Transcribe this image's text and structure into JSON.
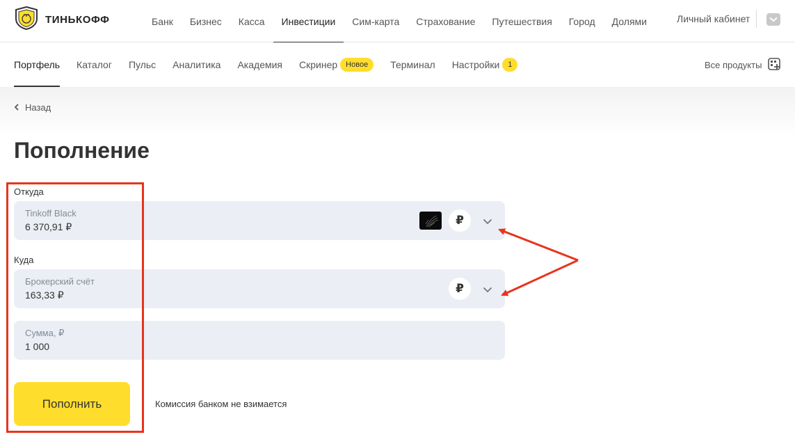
{
  "logo": {
    "text": "ТИНЬКОФФ",
    "icon": "tinkoff-shield-icon"
  },
  "top_nav": {
    "items": [
      {
        "label": "Банк",
        "active": false
      },
      {
        "label": "Бизнес",
        "active": false
      },
      {
        "label": "Касса",
        "active": false
      },
      {
        "label": "Инвестиции",
        "active": true
      },
      {
        "label": "Сим-карта",
        "active": false
      },
      {
        "label": "Страхование",
        "active": false
      },
      {
        "label": "Путешествия",
        "active": false
      },
      {
        "label": "Город",
        "active": false
      },
      {
        "label": "Долями",
        "active": false
      }
    ],
    "cabinet_label": "Личный кабинет",
    "cabinet_icon": "chevron-down-icon"
  },
  "sub_nav": {
    "items": [
      {
        "label": "Портфель",
        "active": true
      },
      {
        "label": "Каталог"
      },
      {
        "label": "Пульс"
      },
      {
        "label": "Аналитика"
      },
      {
        "label": "Академия"
      },
      {
        "label": "Скринер",
        "badge": "Новое"
      },
      {
        "label": "Терминал"
      },
      {
        "label": "Настройки",
        "badge": "1"
      }
    ],
    "all_products_label": "Все продукты",
    "all_products_icon": "grid-plus-icon"
  },
  "back_label": "Назад",
  "page_title": "Пополнение",
  "from": {
    "section_label": "Откуда",
    "name": "Tinkoff Black",
    "amount": "6 370,91 ₽",
    "currency_symbol": "₽",
    "card_icon": "black-card-icon"
  },
  "to": {
    "section_label": "Куда",
    "name": "Брокерский счёт",
    "amount": "163,33 ₽",
    "currency_symbol": "₽"
  },
  "sum": {
    "label": "Сумма, ₽",
    "value": "1 000"
  },
  "submit_label": "Пополнить",
  "commission_text": "Комиссия банком не взимается",
  "colors": {
    "accent_yellow": "#ffdd2d",
    "field_bg": "#ebeef4",
    "annotation_red": "#e8341c"
  }
}
